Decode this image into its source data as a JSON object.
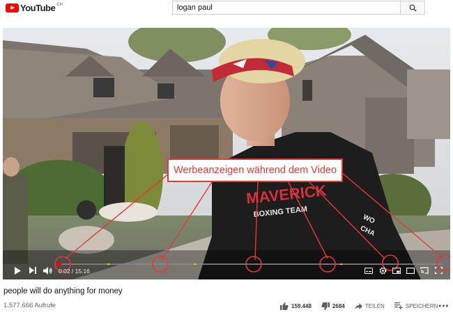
{
  "masthead": {
    "logo_text": "YouTube",
    "logo_region": "CH",
    "search_value": "logan paul",
    "search_icon": "search-icon"
  },
  "player": {
    "annotation": "Werbeanzeigen während dem Video",
    "annotation_color": "#e53935",
    "current_time": "0:02",
    "duration": "15:16",
    "time_separator": " / ",
    "progress_fraction": 0.0022,
    "ad_marker_fractions": [
      0.13,
      0.355,
      0.735
    ],
    "highlighted_positions": [
      "progress-start",
      "ad-marker-1",
      "ad-marker-2",
      "ad-marker-3",
      "settings",
      "fullscreen"
    ],
    "controls": {
      "play_icon": "play-icon",
      "next_icon": "next-icon",
      "volume_icon": "volume-icon",
      "subtitles_icon": "subtitles-icon",
      "settings_icon": "gear-icon",
      "miniplayer_icon": "miniplayer-icon",
      "theater_icon": "theater-icon",
      "cast_icon": "cast-icon",
      "fullscreen_icon": "fullscreen-icon"
    },
    "shirt_text": {
      "line1": "MAVERICK",
      "line2": "BOXING TEAM",
      "sleeve1": "WO",
      "sleeve2": "CHA"
    }
  },
  "video": {
    "title": "people will do anything for money",
    "views": "1.577.666 Aufrufe",
    "likes": "159.448",
    "dislikes": "2684",
    "share_label": "TEILEN",
    "save_label": "SPEICHERN",
    "more_label": "•••"
  }
}
